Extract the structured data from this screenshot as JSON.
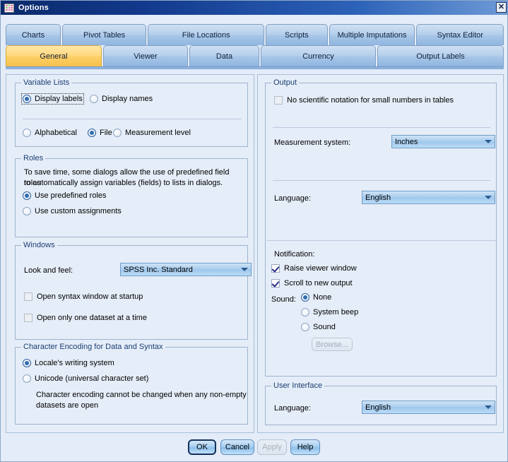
{
  "window": {
    "title": "Options",
    "icon": "table-grid-icon",
    "close_label": "✕"
  },
  "tabs": {
    "row1": [
      {
        "label": "Charts",
        "selected": false
      },
      {
        "label": "Pivot Tables",
        "selected": false
      },
      {
        "label": "File Locations",
        "selected": false
      },
      {
        "label": "Scripts",
        "selected": false
      },
      {
        "label": "Multiple Imputations",
        "selected": false
      },
      {
        "label": "Syntax Editor",
        "selected": false
      }
    ],
    "row2": [
      {
        "label": "General",
        "selected": true
      },
      {
        "label": "Viewer",
        "selected": false
      },
      {
        "label": "Data",
        "selected": false
      },
      {
        "label": "Currency",
        "selected": false
      },
      {
        "label": "Output Labels",
        "selected": false
      }
    ]
  },
  "variable_lists": {
    "title": "Variable Lists",
    "display_labels": "Display labels",
    "display_names": "Display names",
    "alphabetical": "Alphabetical",
    "file": "File",
    "measurement_level": "Measurement level"
  },
  "roles": {
    "title": "Roles",
    "description_line1": "To save time, some dialogs allow the use of predefined field roles",
    "description_line2": "to automatically assign variables (fields) to lists in dialogs.",
    "use_predefined": "Use predefined roles",
    "use_custom": "Use custom assignments"
  },
  "windows": {
    "title": "Windows",
    "look_and_feel_label": "Look and feel:",
    "look_and_feel_value": "SPSS Inc. Standard",
    "open_syntax": "Open syntax window at startup",
    "open_one_dataset": "Open only one dataset at a time"
  },
  "character_encoding": {
    "title": "Character Encoding for Data and Syntax",
    "locale": "Locale's writing system",
    "unicode": "Unicode (universal character set)",
    "note_line1": "Character encoding cannot be changed when any non-empty",
    "note_line2": "datasets are open"
  },
  "output": {
    "title": "Output",
    "no_sci_notation": "No scientific notation for small numbers in tables",
    "measurement_system_label": "Measurement system:",
    "measurement_system_value": "Inches",
    "language_label": "Language:",
    "language_value": "English",
    "notification_label": "Notification:",
    "raise_viewer": "Raise viewer window",
    "scroll_new_output": "Scroll to new output",
    "sound_label": "Sound:",
    "sound_none": "None",
    "sound_system_beep": "System beep",
    "sound_sound": "Sound",
    "browse_button": "Browse..."
  },
  "user_interface": {
    "title": "User Interface",
    "language_label": "Language:",
    "language_value": "English"
  },
  "footer": {
    "ok": "OK",
    "cancel": "Cancel",
    "apply": "Apply",
    "help": "Help"
  },
  "colors": {
    "titlebar_dark": "#0b2a6b",
    "titlebar_light": "#6e9ad6",
    "selected_tab": "#fdcf66",
    "tab": "#a9c7e8",
    "pane_bg": "#e5edf8",
    "group_border": "#9db3d0",
    "group_title_text": "#1b3f73",
    "combo_blue": "#a9cdee",
    "radio_dot": "#2f6dae",
    "check_mark": "#2b2f8a"
  }
}
